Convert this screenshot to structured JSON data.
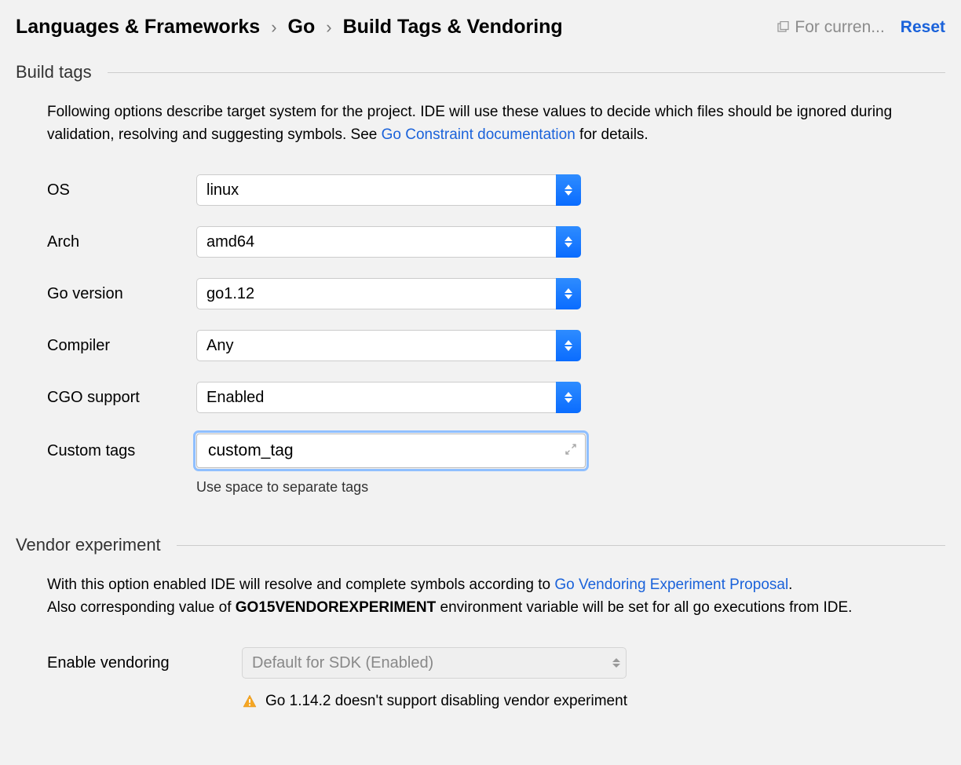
{
  "breadcrumb": {
    "item1": "Languages & Frameworks",
    "item2": "Go",
    "item3": "Build Tags & Vendoring"
  },
  "header": {
    "for_current": "For curren...",
    "reset": "Reset"
  },
  "build_tags": {
    "title": "Build tags",
    "desc1": "Following options describe target system for the project. IDE will use these values to decide which files should be ignored during validation, resolving and suggesting symbols. See ",
    "desc_link": "Go Constraint documentation",
    "desc2": " for details.",
    "fields": {
      "os": {
        "label": "OS",
        "value": "linux"
      },
      "arch": {
        "label": "Arch",
        "value": "amd64"
      },
      "go_version": {
        "label": "Go version",
        "value": "go1.12"
      },
      "compiler": {
        "label": "Compiler",
        "value": "Any"
      },
      "cgo": {
        "label": "CGO support",
        "value": "Enabled"
      },
      "custom_tags": {
        "label": "Custom tags",
        "value": "custom_tag",
        "helper": "Use space to separate tags"
      }
    }
  },
  "vendor": {
    "title": "Vendor experiment",
    "desc1": "With this option enabled IDE will resolve and complete symbols according to ",
    "desc_link": "Go Vendoring Experiment Proposal",
    "desc2": ".",
    "desc3a": "Also corresponding value of ",
    "desc3b": "GO15VENDOREXPERIMENT",
    "desc3c": " environment variable will be set for all go executions from IDE.",
    "enable_label": "Enable vendoring",
    "enable_value": "Default for SDK (Enabled)",
    "warning": "Go 1.14.2 doesn't support disabling vendor experiment"
  }
}
